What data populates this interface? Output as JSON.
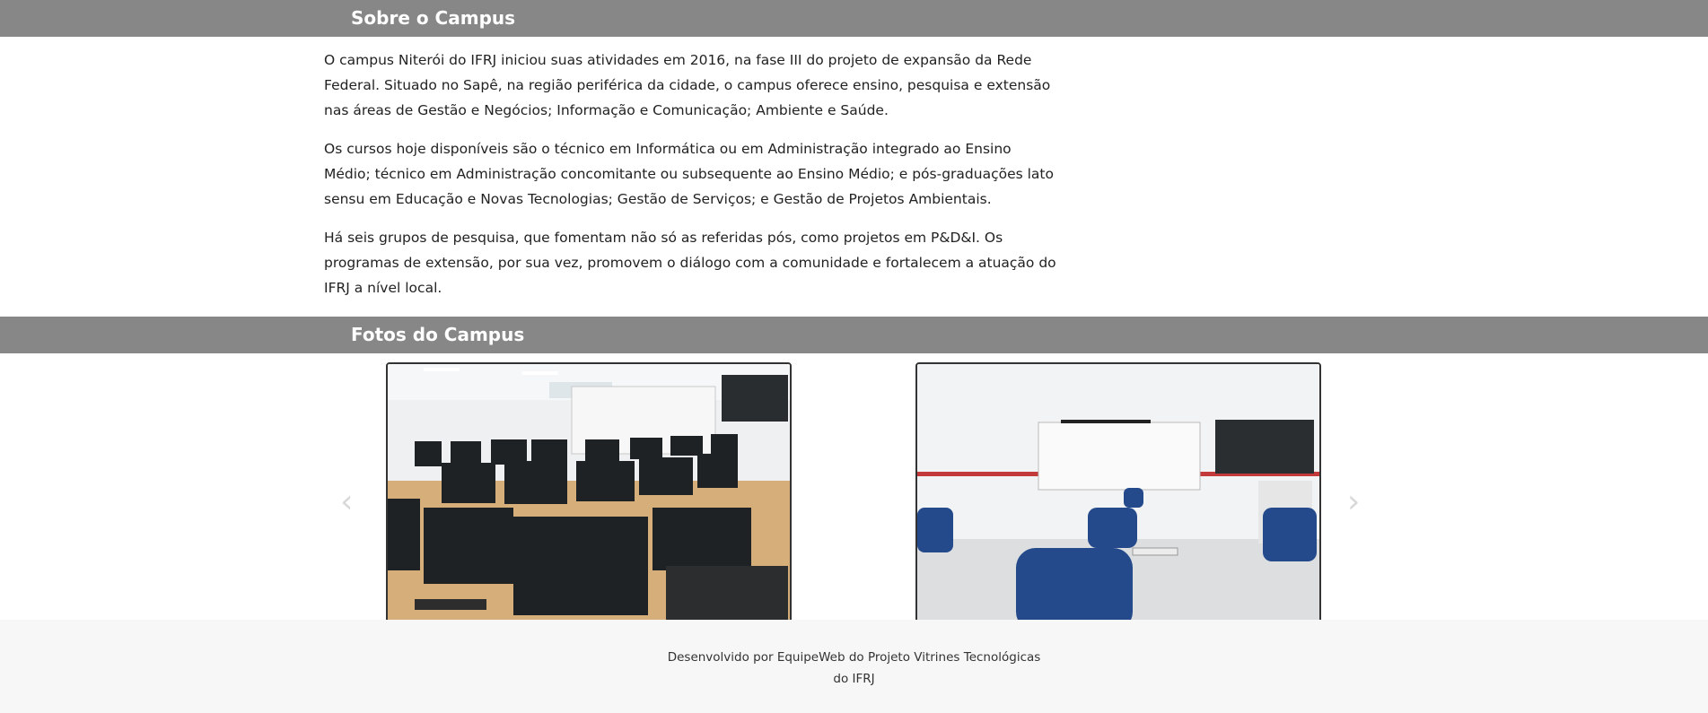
{
  "about": {
    "heading": "Sobre o Campus",
    "paragraphs": [
      "O campus Niterói do IFRJ iniciou suas atividades em 2016, na fase III do projeto de expansão da Rede Federal. Situado no Sapê, na região periférica da cidade, o campus oferece ensino, pesquisa e extensão nas áreas de  Gestão e Negócios; Informação e Comunicação; Ambiente e Saúde.",
      "Os cursos hoje disponíveis são o técnico em Informática ou em Administração integrado ao Ensino Médio; técnico em Administração concomitante ou subsequente ao Ensino Médio; e pós-graduações lato sensu em Educação e Novas Tecnologias; Gestão de Serviços; e Gestão de Projetos Ambientais.",
      "Há seis grupos de pesquisa, que fomentam não só as referidas pós, como projetos em P&D&I. Os programas de extensão, por sua vez, promovem o diálogo com a comunidade e fortalecem a atuação do IFRJ a nível local."
    ]
  },
  "photos": {
    "heading": "Fotos do Campus",
    "prev_icon": "chevron-left-icon",
    "next_icon": "chevron-right-icon",
    "prev_glyph": "‹",
    "next_glyph": "›",
    "slides": [
      "computer-lab-photo",
      "classroom-photo"
    ],
    "dots_total": 5,
    "active_dot": 4
  },
  "footer": {
    "line1": "Desenvolvido por EquipeWeb do Projeto Vitrines Tecnológicas",
    "line2": "do IFRJ"
  }
}
